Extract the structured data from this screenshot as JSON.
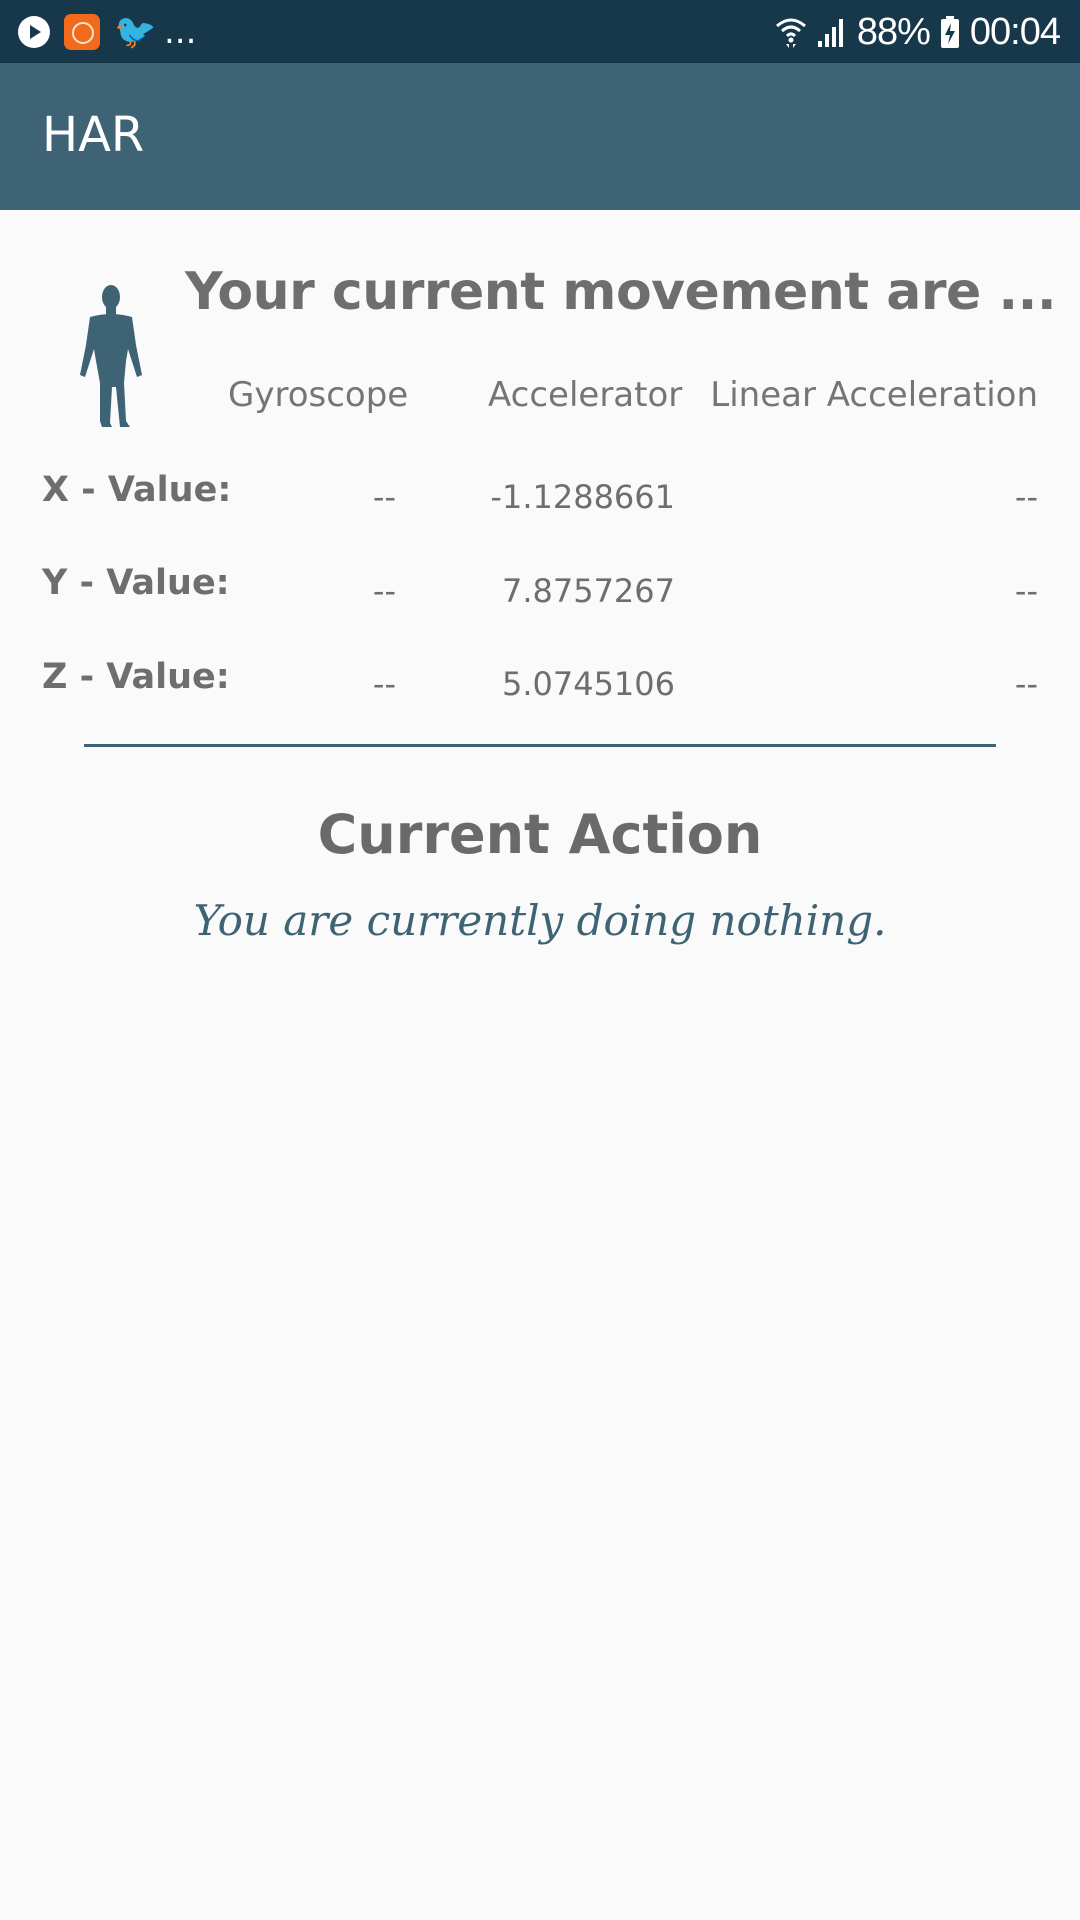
{
  "status_bar": {
    "battery_percent": "88%",
    "time": "00:04",
    "overflow": "...",
    "icons": [
      "play-notification-icon",
      "mi-app-icon",
      "twitter-icon",
      "wifi-icon",
      "signal-icon",
      "battery-charging-icon"
    ],
    "colors": {
      "background": "#17374b",
      "foreground": "#ffffff",
      "mi_icon": "#f26a1b"
    }
  },
  "app_bar": {
    "title": "HAR",
    "color": "#3d6375"
  },
  "sensor_panel": {
    "heading": "Your current movement are ...",
    "icon": "human-figure-icon",
    "columns": [
      "Gyroscope",
      "Accelerator",
      "Linear Acceleration"
    ],
    "rows": [
      {
        "label": "X - Value:",
        "gyroscope": "--",
        "accelerator": "-1.1288661",
        "linear": "--"
      },
      {
        "label": "Y - Value:",
        "gyroscope": "--",
        "accelerator": "7.8757267",
        "linear": "--"
      },
      {
        "label": "Z - Value:",
        "gyroscope": "--",
        "accelerator": "5.0745106",
        "linear": "--"
      }
    ]
  },
  "action_panel": {
    "title": "Current Action",
    "status": "You are currently doing nothing.",
    "status_color": "#3d6375"
  }
}
